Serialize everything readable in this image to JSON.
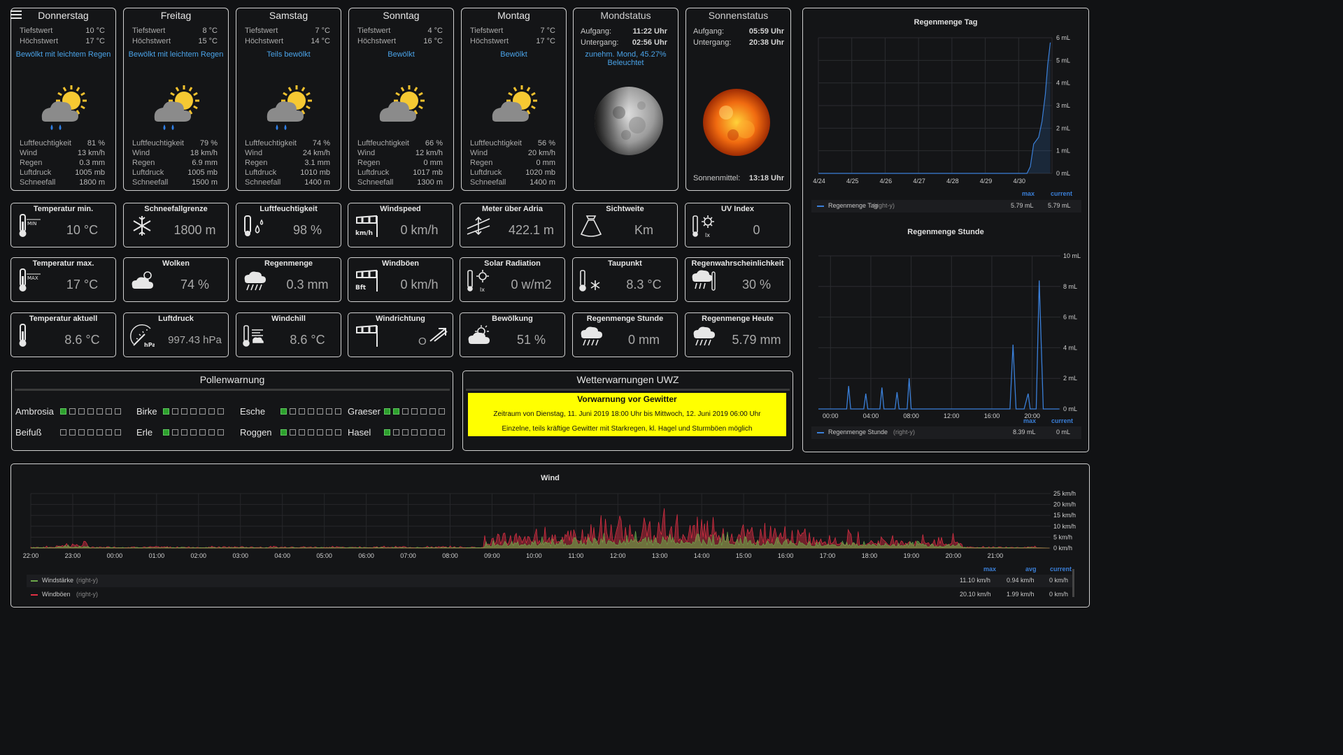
{
  "forecast": [
    {
      "day": "Donnerstag",
      "low_label": "Tiefstwert",
      "low": "10 °C",
      "high_label": "Höchstwert",
      "high": "17 °C",
      "desc": "Bewölkt mit leichtem Regen",
      "icon": "cloud-sun-rain-icon",
      "hum_label": "Luftfeuchtigkeit",
      "hum": "81 %",
      "wind_label": "Wind",
      "wind": "13 km/h",
      "rain_label": "Regen",
      "rain": "0.3 mm",
      "press_label": "Luftdruck",
      "press": "1005 mb",
      "snow_label": "Schneefall",
      "snow": "1800 m"
    },
    {
      "day": "Freitag",
      "low_label": "Tiefstwert",
      "low": "8 °C",
      "high_label": "Höchstwert",
      "high": "15 °C",
      "desc": "Bewölkt mit leichtem Regen",
      "icon": "cloud-sun-rain-icon",
      "hum_label": "Luftfeuchtigkeit",
      "hum": "79 %",
      "wind_label": "Wind",
      "wind": "18 km/h",
      "rain_label": "Regen",
      "rain": "6.9 mm",
      "press_label": "Luftdruck",
      "press": "1005 mb",
      "snow_label": "Schneefall",
      "snow": "1500 m"
    },
    {
      "day": "Samstag",
      "low_label": "Tiefstwert",
      "low": "7 °C",
      "high_label": "Höchstwert",
      "high": "14 °C",
      "desc": "Teils bewölkt",
      "icon": "cloud-sun-rain-icon",
      "hum_label": "Luftfeuchtigkeit",
      "hum": "74 %",
      "wind_label": "Wind",
      "wind": "24 km/h",
      "rain_label": "Regen",
      "rain": "3.1 mm",
      "press_label": "Luftdruck",
      "press": "1010 mb",
      "snow_label": "Schneefall",
      "snow": "1400 m"
    },
    {
      "day": "Sonntag",
      "low_label": "Tiefstwert",
      "low": "4 °C",
      "high_label": "Höchstwert",
      "high": "16 °C",
      "desc": "Bewölkt",
      "icon": "cloud-sun-icon",
      "hum_label": "Luftfeuchtigkeit",
      "hum": "66 %",
      "wind_label": "Wind",
      "wind": "12 km/h",
      "rain_label": "Regen",
      "rain": "0 mm",
      "press_label": "Luftdruck",
      "press": "1017 mb",
      "snow_label": "Schneefall",
      "snow": "1300 m"
    },
    {
      "day": "Montag",
      "low_label": "Tiefstwert",
      "low": "7 °C",
      "high_label": "Höchstwert",
      "high": "17 °C",
      "desc": "Bewölkt",
      "icon": "cloud-sun-icon",
      "hum_label": "Luftfeuchtigkeit",
      "hum": "56 %",
      "wind_label": "Wind",
      "wind": "20 km/h",
      "rain_label": "Regen",
      "rain": "0 mm",
      "press_label": "Luftdruck",
      "press": "1020 mb",
      "snow_label": "Schneefall",
      "snow": "1400 m"
    }
  ],
  "moon": {
    "title": "Mondstatus",
    "rise_label": "Aufgang:",
    "rise": "11:22 Uhr",
    "set_label": "Untergang:",
    "set": "02:56 Uhr",
    "phase_line1": "zunehm. Mond, 45.27%",
    "phase_line2": "Beleuchtet"
  },
  "sun": {
    "title": "Sonnenstatus",
    "rise_label": "Aufgang:",
    "rise": "05:59 Uhr",
    "set_label": "Untergang:",
    "set": "20:38 Uhr",
    "noon_label": "Sonnenmittel:",
    "noon": "13:18 Uhr"
  },
  "tiles": [
    {
      "title": "Temperatur min.",
      "value": "10 °C",
      "icon": "thermometer-min-icon"
    },
    {
      "title": "Schneefallgrenze",
      "value": "1800 m",
      "icon": "snowflake-icon"
    },
    {
      "title": "Luftfeuchtigkeit",
      "value": "98 %",
      "icon": "humidity-icon"
    },
    {
      "title": "Windspeed",
      "value": "0 km/h",
      "icon": "windsock-kmh-icon"
    },
    {
      "title": "Meter über Adria",
      "value": "422.1 m",
      "icon": "altitude-icon"
    },
    {
      "title": "Sichtweite",
      "value": "Km",
      "icon": "visibility-icon"
    },
    {
      "title": "UV Index",
      "value": "0",
      "icon": "uv-index-icon"
    },
    {
      "title": "Temperatur max.",
      "value": "17 °C",
      "icon": "thermometer-max-icon"
    },
    {
      "title": "Wolken",
      "value": "74 %",
      "icon": "clouds-icon"
    },
    {
      "title": "Regenmenge",
      "value": "0.3 mm",
      "icon": "rain-cloud-icon"
    },
    {
      "title": "Windböen",
      "value": "0 km/h",
      "icon": "windsock-bft-icon"
    },
    {
      "title": "Solar Radiation",
      "value": "0 w/m2",
      "icon": "solar-radiation-icon"
    },
    {
      "title": "Taupunkt",
      "value": "8.3 °C",
      "icon": "dewpoint-icon"
    },
    {
      "title": "Regenwahrscheinlichkeit",
      "value": "30 %",
      "icon": "rain-probability-icon"
    },
    {
      "title": "Temperatur aktuell",
      "value": "8.6 °C",
      "icon": "thermometer-icon"
    },
    {
      "title": "Luftdruck",
      "value": "997.43 hPa",
      "icon": "barometer-icon"
    },
    {
      "title": "Windchill",
      "value": "8.6 °C",
      "icon": "windchill-icon"
    },
    {
      "title": "Windrichtung",
      "value": "O",
      "icon": "wind-direction-icon"
    },
    {
      "title": "Bewölkung",
      "value": "51 %",
      "icon": "cloud-cover-icon"
    },
    {
      "title": "Regenmenge Stunde",
      "value": "0 mm",
      "icon": "rain-hour-icon"
    },
    {
      "title": "Regenmenge Heute",
      "value": "5.79 mm",
      "icon": "rain-today-icon"
    }
  ],
  "pollen": {
    "title": "Pollenwarnung",
    "items": [
      {
        "name": "Ambrosia",
        "level": 1
      },
      {
        "name": "Birke",
        "level": 1
      },
      {
        "name": "Esche",
        "level": 1
      },
      {
        "name": "Graeser",
        "level": 2
      },
      {
        "name": "Beifuß",
        "level": 0
      },
      {
        "name": "Erle",
        "level": 1
      },
      {
        "name": "Roggen",
        "level": 1
      },
      {
        "name": "Hasel",
        "level": 1
      }
    ]
  },
  "uwz": {
    "title": "Wetterwarnungen UWZ",
    "headline": "Vorwarnung vor Gewitter",
    "period": "Zeitraum von Dienstag, 11. Juni 2019 18:00 Uhr bis Mittwoch, 12. Juni 2019 06:00 Uhr",
    "text": "Einzelne, teils kräftige Gewitter mit Starkregen, kl. Hagel und Sturmböen möglich",
    "color": "#ffff00"
  },
  "chart_data": [
    {
      "type": "line",
      "title": "Regenmenge Tag",
      "x": [
        "4/24",
        "4/25",
        "4/26",
        "4/27",
        "4/28",
        "4/29",
        "4/30"
      ],
      "yticks": [
        "6 mL",
        "5 mL",
        "4 mL",
        "3 mL",
        "2 mL",
        "1 mL",
        "0 mL"
      ],
      "ylim": [
        0,
        6
      ],
      "series": [
        {
          "name": "Regenmenge Tag",
          "axis": "(right-y)",
          "color": "#3a7fd8",
          "points": [
            [
              6.0,
              0
            ],
            [
              6.25,
              0
            ],
            [
              6.35,
              0.3
            ],
            [
              6.45,
              1.3
            ],
            [
              6.6,
              1.6
            ],
            [
              6.7,
              2.3
            ],
            [
              6.8,
              3.5
            ],
            [
              6.87,
              4.8
            ],
            [
              6.95,
              5.79
            ]
          ],
          "max": "5.79 mL",
          "current": "5.79 mL"
        }
      ],
      "legend_headers": {
        "max": "max",
        "current": "current"
      }
    },
    {
      "type": "line",
      "title": "Regenmenge Stunde",
      "x": [
        "00:00",
        "04:00",
        "08:00",
        "12:00",
        "16:00",
        "20:00"
      ],
      "yticks": [
        "10 mL",
        "8 mL",
        "6 mL",
        "4 mL",
        "2 mL",
        "0 mL"
      ],
      "ylim": [
        0,
        10
      ],
      "series": [
        {
          "name": "Regenmenge Stunde",
          "axis": "(right-y)",
          "color": "#3a7fd8",
          "points": [
            [
              0,
              0
            ],
            [
              2.8,
              0
            ],
            [
              3.0,
              1.5
            ],
            [
              3.2,
              0
            ],
            [
              4.5,
              0
            ],
            [
              4.7,
              1.0
            ],
            [
              4.9,
              0
            ],
            [
              6.1,
              0
            ],
            [
              6.3,
              1.4
            ],
            [
              6.5,
              0
            ],
            [
              7.6,
              0
            ],
            [
              7.8,
              1.1
            ],
            [
              8.0,
              0
            ],
            [
              8.8,
              0
            ],
            [
              9.0,
              2.0
            ],
            [
              9.2,
              0
            ],
            [
              19.0,
              0
            ],
            [
              19.3,
              4.2
            ],
            [
              19.6,
              0
            ],
            [
              20.4,
              0
            ],
            [
              20.8,
              1.0
            ],
            [
              21.0,
              0
            ],
            [
              21.6,
              0
            ],
            [
              21.9,
              8.39
            ],
            [
              22.3,
              0
            ],
            [
              23.9,
              0
            ]
          ],
          "max": "8.39 mL",
          "current": "0 mL"
        }
      ],
      "legend_headers": {
        "max": "max",
        "current": "current"
      }
    },
    {
      "type": "area",
      "title": "Wind",
      "x": [
        "22:00",
        "23:00",
        "00:00",
        "01:00",
        "02:00",
        "03:00",
        "04:00",
        "05:00",
        "06:00",
        "07:00",
        "08:00",
        "09:00",
        "10:00",
        "11:00",
        "12:00",
        "13:00",
        "14:00",
        "15:00",
        "16:00",
        "17:00",
        "18:00",
        "19:00",
        "20:00",
        "21:00"
      ],
      "yticks": [
        "25 km/h",
        "20 km/h",
        "15 km/h",
        "10 km/h",
        "5 km/h",
        "0 km/h"
      ],
      "ylim": [
        0,
        25
      ],
      "series": [
        {
          "name": "Windstärke",
          "axis": "(right-y)",
          "color": "#6ca84a",
          "max": "11.10 km/h",
          "avg": "0.94 km/h",
          "current": "0 km/h"
        },
        {
          "name": "Windböen",
          "axis": "(right-y)",
          "color": "#e02f44",
          "max": "20.10 km/h",
          "avg": "1.99 km/h",
          "current": "0 km/h"
        }
      ],
      "legend_headers": {
        "max": "max",
        "avg": "avg",
        "current": "current"
      }
    }
  ]
}
